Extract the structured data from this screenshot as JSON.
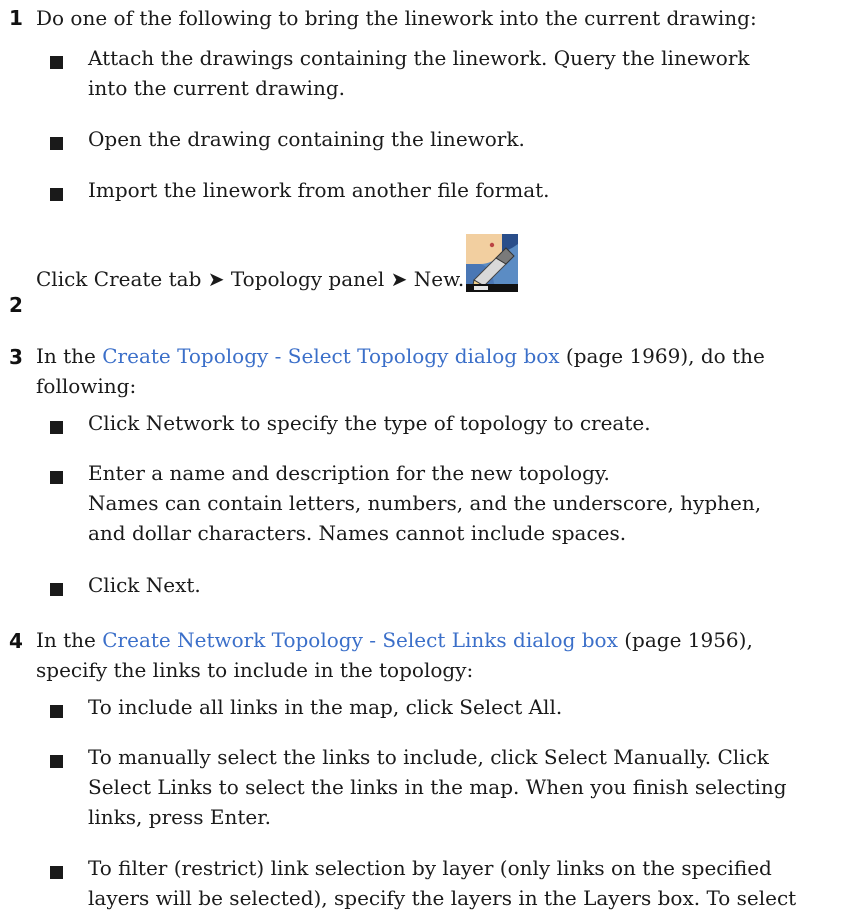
{
  "steps": [
    {
      "number": "1",
      "text": "Do one of the following to bring the linework into the current drawing:",
      "bullets": [
        {
          "line1": "Attach the drawings containing the linework. Query the linework",
          "line2": "into the current drawing."
        },
        {
          "line1": "Open the drawing containing the linework."
        },
        {
          "line1": "Import the linework from another file format."
        }
      ]
    },
    {
      "number": "2",
      "text": "Click Create tab ➤ Topology panel ➤ New.",
      "icon": "new-topology-icon"
    },
    {
      "number": "3",
      "text_before": "In the ",
      "link": "Create Topology - Select Topology dialog box",
      "text_after": " (page 1969), do the",
      "text_line2": "following:",
      "bullets": [
        {
          "line1": "Click Network to specify the type of topology to create."
        },
        {
          "line1": "Enter a name and description for the new topology.",
          "line2": "Names can contain letters, numbers, and the underscore, hyphen,",
          "line3": "and dollar characters. Names cannot include spaces."
        },
        {
          "line1": "Click Next."
        }
      ]
    },
    {
      "number": "4",
      "text_before": "In the ",
      "link": "Create Network Topology - Select Links dialog box",
      "text_after": " (page 1956),",
      "text_line2": "specify the links to include in the topology:",
      "bullets": [
        {
          "line1": "To include all links in the map, click Select All."
        },
        {
          "line1": "To manually select the links to include, click Select Manually. Click",
          "line2": "Select Links to select the links in the map. When you finish selecting",
          "line3": "links, press Enter."
        },
        {
          "line1": "To filter (restrict) link selection by layer (only links on the specified",
          "line2": "layers will be selected), specify the layers in the Layers box. To select"
        }
      ]
    }
  ]
}
